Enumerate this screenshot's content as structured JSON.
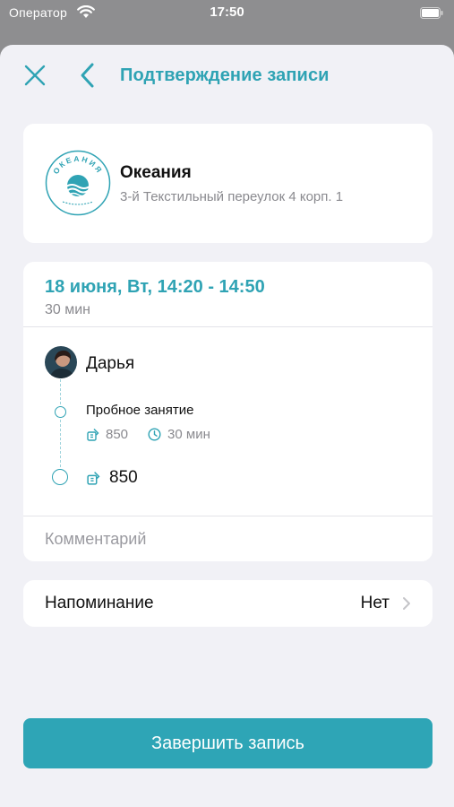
{
  "status_bar": {
    "carrier": "Оператор",
    "time": "17:50"
  },
  "nav": {
    "title": "Подтверждение записи",
    "close_icon": "close-icon",
    "back_icon": "chevron-left-icon"
  },
  "salon": {
    "name": "Океания",
    "address": "3-й Текстильный переулок 4 корп. 1",
    "logo_text": "ОКЕАНИЯ"
  },
  "booking": {
    "date_time": "18 июня, Вт, 14:20 - 14:50",
    "duration": "30 мин",
    "master_name": "Дарья",
    "service": {
      "name": "Пробное занятие",
      "price": "850",
      "duration": "30 мин"
    },
    "total": "850",
    "comment_placeholder": "Комментарий"
  },
  "reminder": {
    "label": "Напоминание",
    "value": "Нет"
  },
  "actions": {
    "complete_label": "Завершить запись"
  },
  "colors": {
    "accent": "#2fa3b4",
    "button": "#2ea5b6",
    "sheet_background": "#f1f1f6",
    "dimmed_background": "#8e8e90"
  }
}
